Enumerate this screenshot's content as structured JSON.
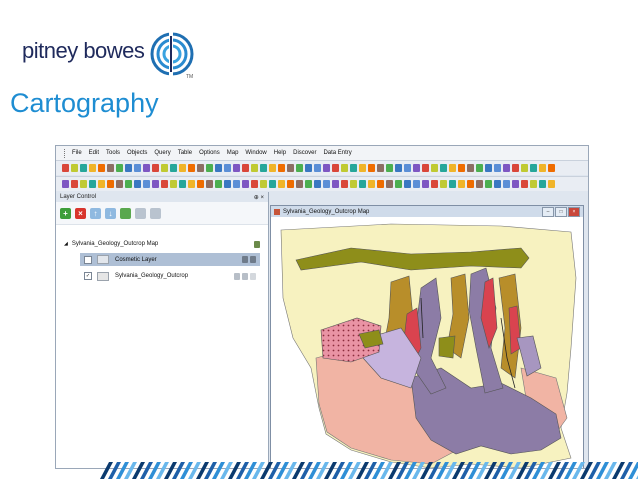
{
  "brand": {
    "name": "pitney bowes",
    "tm": "TM"
  },
  "slide_title": "Cartography",
  "menu": [
    "File",
    "Edit",
    "Tools",
    "Objects",
    "Query",
    "Table",
    "Options",
    "Map",
    "Window",
    "Help",
    "Discover",
    "Data Entry"
  ],
  "layer_panel": {
    "title": "Layer Control",
    "pin": "⊕ ×",
    "map_name": "Sylvania_Geology_Outcrop Map",
    "layers": [
      {
        "label": "Cosmetic Layer",
        "checked": false,
        "selected": true
      },
      {
        "label": "Sylvania_Geology_Outcrop",
        "checked": true,
        "selected": false
      }
    ]
  },
  "map_window": {
    "title": "Sylvania_Geology_Outcrop Map",
    "minimize": "–",
    "maximize": "□",
    "close": "×"
  },
  "colors": {
    "title": "#1e8dd2",
    "brand": "#1f2a5c",
    "selection": "#aebfd5",
    "geology": {
      "base_cream": "#f7f2c0",
      "salmon": "#f1b4a4",
      "purple": "#8c7ca6",
      "olive": "#8e8e1a",
      "ochre": "#b88e2a",
      "red": "#d9434f",
      "pink_dotted": "#e993a4",
      "lavender": "#c6b4de",
      "light_purple": "#a796c0"
    }
  }
}
